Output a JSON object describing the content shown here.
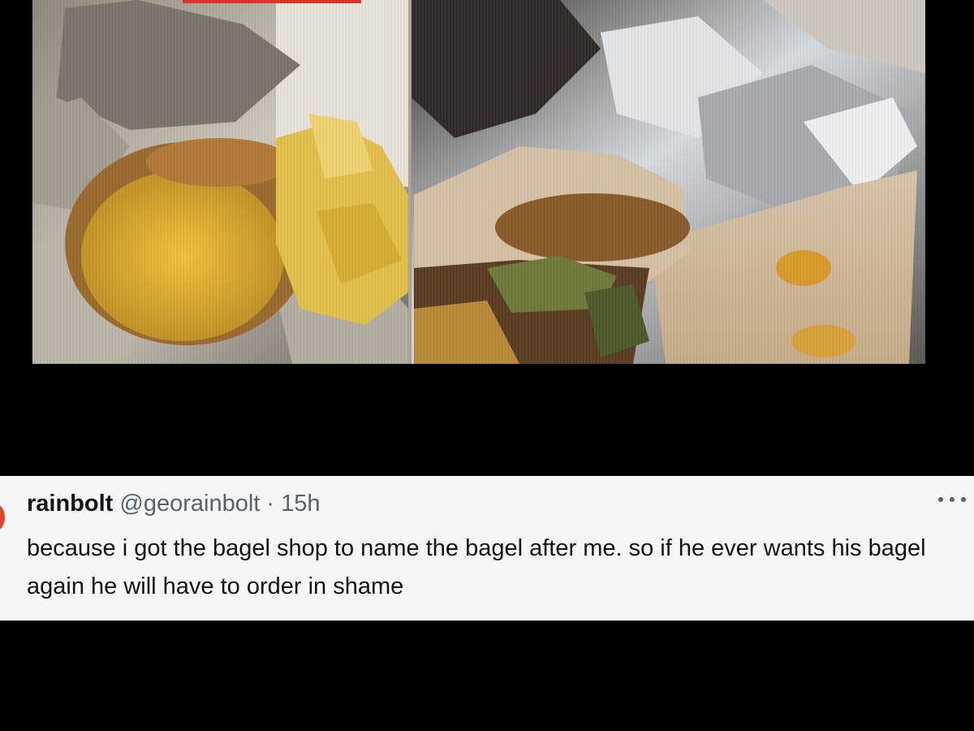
{
  "tweet": {
    "display_name": "rainbolt",
    "handle": "@georainbolt",
    "separator": "·",
    "timestamp": "15h",
    "text": "because i got the bagel shop to name the bagel after me. so if he ever wants his bagel again he will have to order in shame",
    "more_icon": "more-horizontal-icon"
  },
  "colors": {
    "background": "#000000",
    "card": "#f7f7f7",
    "text": "#0f1419",
    "muted": "#536471",
    "avatar_accent": "#e0442c"
  }
}
